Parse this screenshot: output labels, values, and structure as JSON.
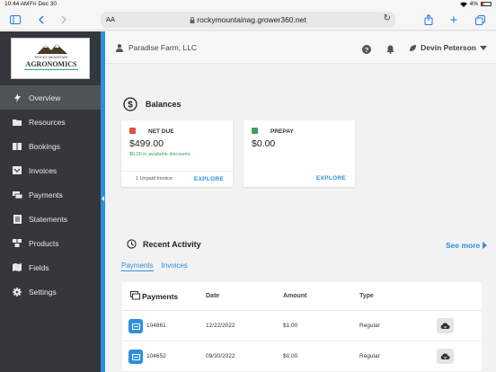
{
  "status_bar": {
    "time": "10:44 AM",
    "date": "Fri Dec 30",
    "battery": "4%"
  },
  "browser": {
    "aa_label": "AA",
    "url": "rockymountainag.grower360.net"
  },
  "logo": {
    "line1": "ROCKY MOUNTAIN",
    "line2": "AGRONOMICS"
  },
  "sidebar": {
    "items": [
      {
        "label": "Overview",
        "icon": "bolt-icon",
        "active": true
      },
      {
        "label": "Resources",
        "icon": "folder-icon"
      },
      {
        "label": "Bookings",
        "icon": "book-icon"
      },
      {
        "label": "Invoices",
        "icon": "inbox-icon"
      },
      {
        "label": "Payments",
        "icon": "money-icon"
      },
      {
        "label": "Statements",
        "icon": "list-icon"
      },
      {
        "label": "Products",
        "icon": "boxes-icon"
      },
      {
        "label": "Fields",
        "icon": "map-icon"
      },
      {
        "label": "Settings",
        "icon": "gear-icon"
      }
    ]
  },
  "header": {
    "farm": "Paradise Farm, LLC",
    "user": "Devin Peterson"
  },
  "balances": {
    "title": "Balances",
    "net_due": {
      "label": "NET DUE",
      "amount": "$499.00",
      "discount": "$0.00 in available discounts",
      "unpaid": "1 Unpaid Invoice",
      "explore": "EXPLORE",
      "color": "#e0523f"
    },
    "prepay": {
      "label": "PREPAY",
      "amount": "$0.00",
      "explore": "EXPLORE",
      "color": "#3aa35a"
    }
  },
  "recent": {
    "title": "Recent Activity",
    "see_more": "See more",
    "tabs": [
      "Payments",
      "Invoices"
    ],
    "table": {
      "title": "Payments",
      "headers": [
        "Date",
        "Amount",
        "Type"
      ],
      "rows": [
        {
          "id": "104861",
          "date": "12/22/2022",
          "amount": "$1.00",
          "type": "Regular"
        },
        {
          "id": "104652",
          "date": "09/30/2022",
          "amount": "$0.00",
          "type": "Regular"
        }
      ]
    }
  },
  "colors": {
    "accent": "#2d8fde",
    "sidebar": "#34383c"
  }
}
